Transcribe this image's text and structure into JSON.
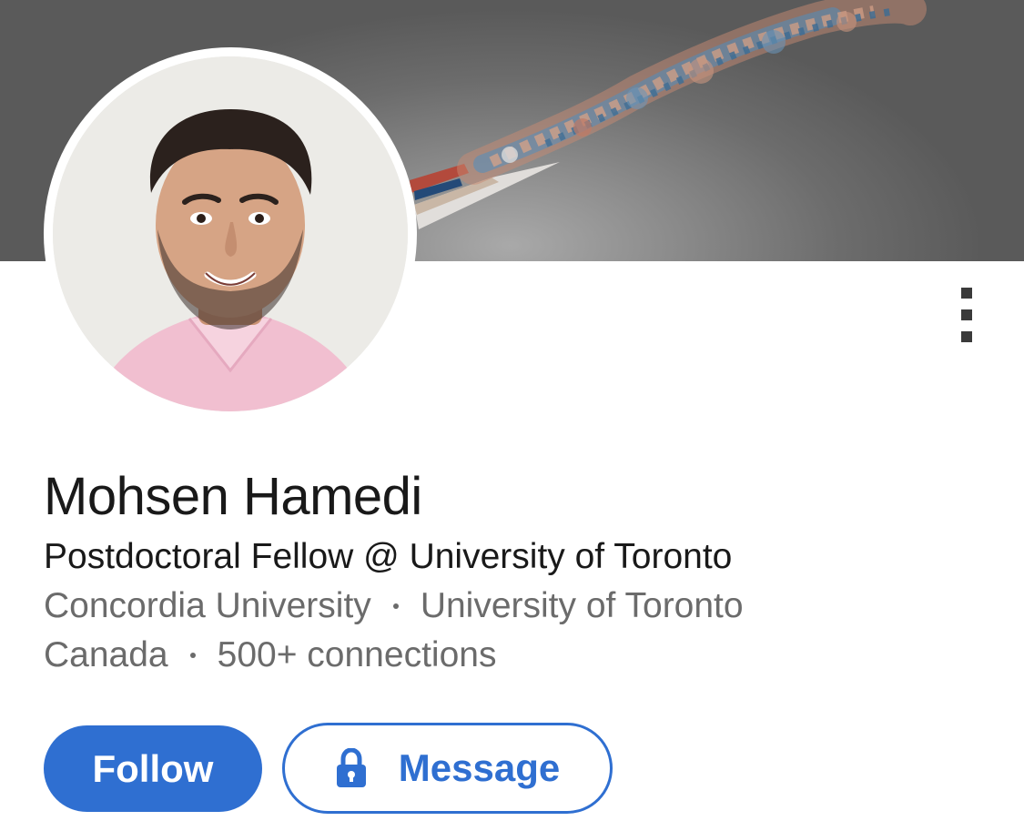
{
  "profile": {
    "name": "Mohsen Hamedi",
    "headline": "Postdoctoral Fellow @ University of Toronto",
    "education": "Concordia University",
    "employer": "University of Toronto",
    "location": "Canada",
    "connections": "500+ connections"
  },
  "actions": {
    "follow_label": "Follow",
    "message_label": "Message"
  },
  "icons": {
    "more": "more-vertical-icon",
    "lock": "lock-icon"
  },
  "colors": {
    "accent": "#2f6fd1",
    "text_primary": "#191919",
    "text_secondary": "#6b6b6b",
    "menu_dots": "#3a3a3a"
  }
}
